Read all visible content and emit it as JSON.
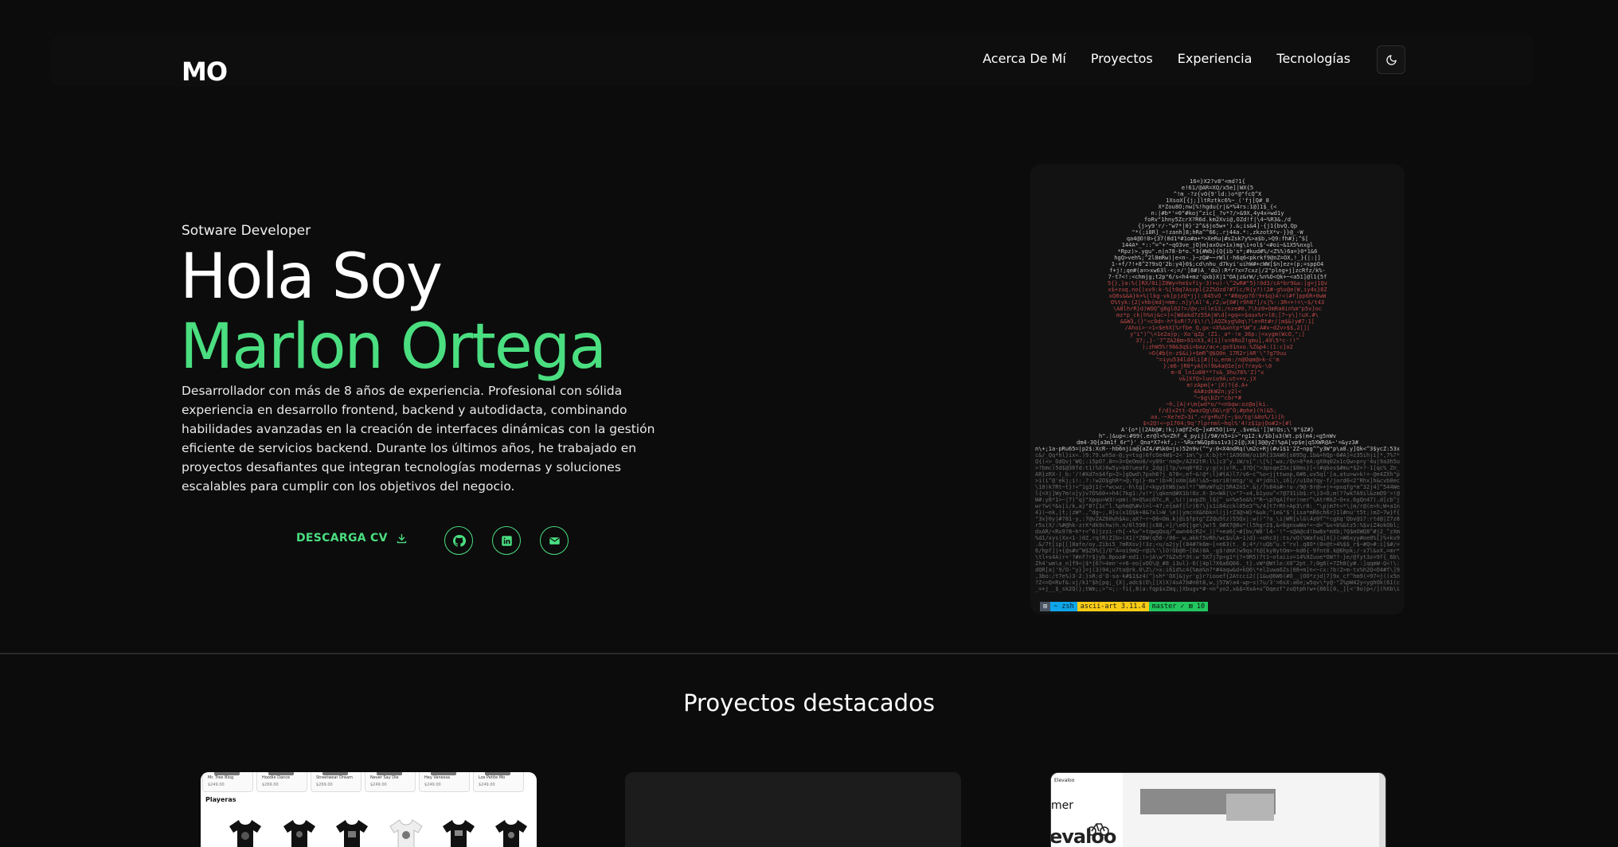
{
  "navbar": {
    "logo": "MO",
    "links": [
      "Acerca De Mí",
      "Proyectos",
      "Experiencia",
      "Tecnologías"
    ],
    "theme_toggle_icon": "moon-icon"
  },
  "hero": {
    "subtitle": "Sotware Developer",
    "greeting": "Hola Soy",
    "name": "Marlon Ortega",
    "description": "Desarrollador con más de 8 años de experiencia. Profesional con sólida experiencia en desarrollo frontend, backend y autodidacta, combinando habilidades avanzadas en la creación de interfaces dinámicas con la gestión eficiente de servicios backend. Durante los últimos años, he trabajado en proyectos desafiantes que integran tecnologías modernas y soluciones escalables para cumplir con los objetivos del negocio.",
    "cv_button": "DESCARGA CV",
    "cv_icon": "download-icon",
    "social_icons": [
      "github-icon",
      "linkedin-icon",
      "mail-icon"
    ]
  },
  "ascii_card": {
    "status_prompt": "⊞",
    "status_shell": "~ zsh",
    "status_dir": "ascii-art 3.11.4",
    "status_branch": "master ✓ ⊠ 10"
  },
  "projects": {
    "title": "Proyectos destacados",
    "card1": {
      "tabs": [
        {
          "name": "Mr. Tree Blog",
          "price": "$249.00"
        },
        {
          "name": "Hoodie Dance",
          "price": "$269.00"
        },
        {
          "name": "Streetwear Dream",
          "price": "$269.00"
        },
        {
          "name": "Never Say Die",
          "price": "$249.00"
        },
        {
          "name": "Hey Vanessa",
          "price": "$249.00"
        },
        {
          "name": "Los Petite Mo",
          "price": "$249.00"
        }
      ],
      "section": "Playeras"
    },
    "card3": {
      "logo": "Elevaloo",
      "partial_word": "mer",
      "brand": "evaloo"
    }
  },
  "colors": {
    "background": "#0c0c0c",
    "accent": "#4ade80",
    "text": "#ffffff"
  }
}
